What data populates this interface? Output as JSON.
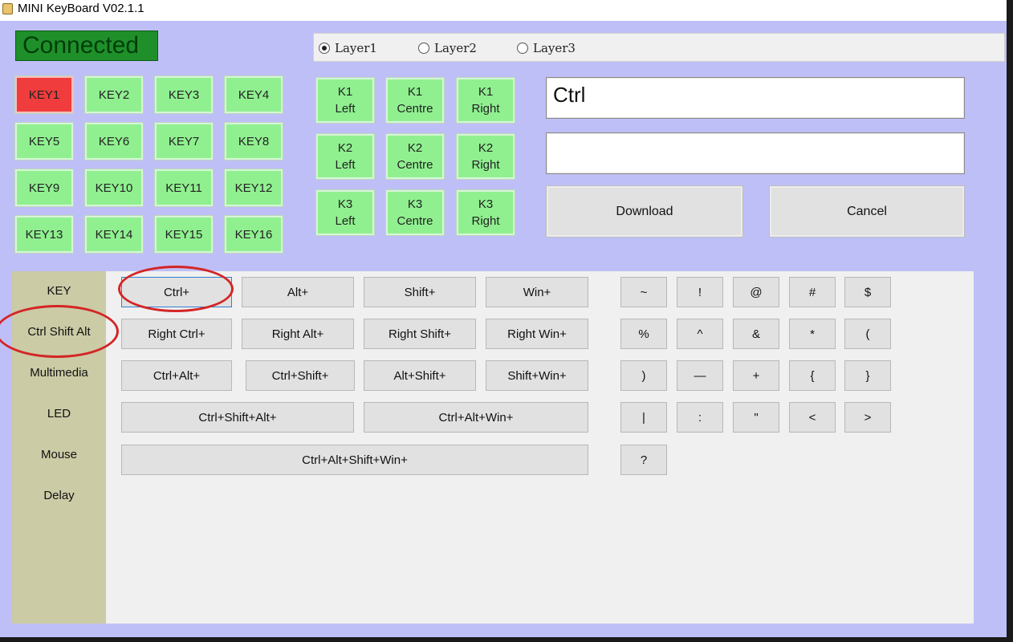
{
  "window": {
    "title": "MINI KeyBoard V02.1.1"
  },
  "status": {
    "text": "Connected"
  },
  "layers": [
    {
      "label": "Layer1",
      "selected": true
    },
    {
      "label": "Layer2",
      "selected": false
    },
    {
      "label": "Layer3",
      "selected": false
    }
  ],
  "keys": [
    "KEY1",
    "KEY2",
    "KEY3",
    "KEY4",
    "KEY5",
    "KEY6",
    "KEY7",
    "KEY8",
    "KEY9",
    "KEY10",
    "KEY11",
    "KEY12",
    "KEY13",
    "KEY14",
    "KEY15",
    "KEY16"
  ],
  "active_key": "KEY1",
  "knobs": [
    {
      "line1": "K1",
      "line2": "Left"
    },
    {
      "line1": "K1",
      "line2": "Centre"
    },
    {
      "line1": "K1",
      "line2": "Right"
    },
    {
      "line1": "K2",
      "line2": "Left"
    },
    {
      "line1": "K2",
      "line2": "Centre"
    },
    {
      "line1": "K2",
      "line2": "Right"
    },
    {
      "line1": "K3",
      "line2": "Left"
    },
    {
      "line1": "K3",
      "line2": "Centre"
    },
    {
      "line1": "K3",
      "line2": "Right"
    }
  ],
  "fields": {
    "field1_value": "Ctrl",
    "field2_value": ""
  },
  "actions": {
    "download": "Download",
    "cancel": "Cancel"
  },
  "sidebar": {
    "items": [
      "KEY",
      "Ctrl Shift Alt",
      "Multimedia",
      "LED",
      "Mouse",
      "Delay"
    ],
    "selected": "Ctrl Shift Alt"
  },
  "modifiers": [
    "Ctrl+",
    "Alt+",
    "Shift+",
    "Win+",
    "Right  Ctrl+",
    "Right Alt+",
    "Right Shift+",
    "Right Win+",
    "Ctrl+Alt+",
    "Ctrl+Shift+",
    "Alt+Shift+",
    "Shift+Win+",
    "Ctrl+Shift+Alt+",
    "Ctrl+Alt+Win+",
    "Ctrl+Alt+Shift+Win+"
  ],
  "focused_modifier": "Ctrl+",
  "symbols": [
    "~",
    "!",
    "@",
    "#",
    "$",
    "%",
    "^",
    "&",
    "*",
    "(",
    ")",
    "—",
    "+",
    "{",
    "}",
    "|",
    ":",
    "\"",
    "<",
    ">",
    "?"
  ],
  "annotations": {
    "color": "#d42525"
  }
}
